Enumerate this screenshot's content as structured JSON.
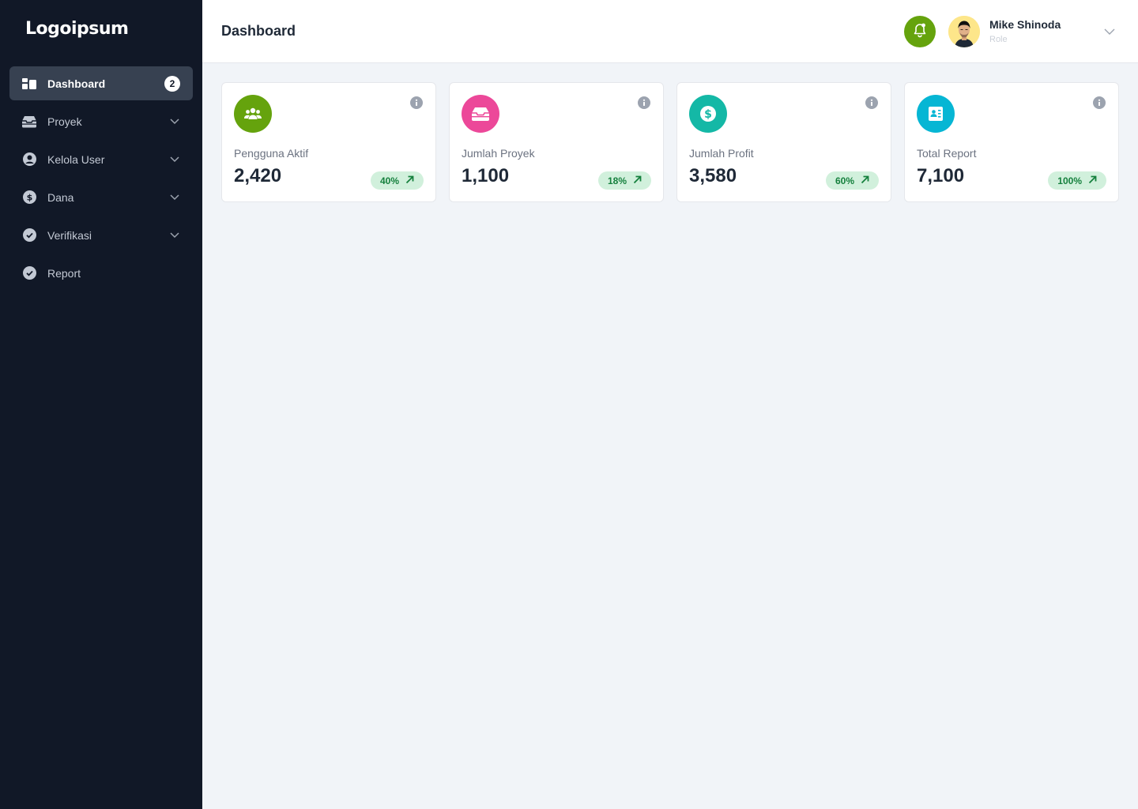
{
  "brand": {
    "logo_text": "Logoipsum"
  },
  "sidebar": {
    "items": [
      {
        "label": "Dashboard",
        "icon": "dashboard-icon",
        "badge": "2",
        "active": true
      },
      {
        "label": "Proyek",
        "icon": "inbox-icon",
        "expandable": true
      },
      {
        "label": "Kelola User",
        "icon": "user-circle-icon",
        "expandable": true
      },
      {
        "label": "Dana",
        "icon": "dollar-circle-icon",
        "expandable": true
      },
      {
        "label": "Verifikasi",
        "icon": "check-circle-icon",
        "expandable": true
      },
      {
        "label": "Report",
        "icon": "check-circle-icon"
      }
    ]
  },
  "header": {
    "title": "Dashboard",
    "user": {
      "name": "Mike Shinoda",
      "role": "Role"
    }
  },
  "cards": [
    {
      "label": "Pengguna Aktif",
      "value": "2,420",
      "trend": "40%",
      "icon": "users-icon",
      "color": "#65a30d"
    },
    {
      "label": "Jumlah Proyek",
      "value": "1,100",
      "trend": "18%",
      "icon": "inbox-icon",
      "color": "#ec4899"
    },
    {
      "label": "Jumlah Profit",
      "value": "3,580",
      "trend": "60%",
      "icon": "dollar-icon",
      "color": "#14b8a6"
    },
    {
      "label": "Total Report",
      "value": "7,100",
      "trend": "100%",
      "icon": "report-icon",
      "color": "#06b6d4"
    }
  ],
  "colors": {
    "sidebar_bg": "#111827",
    "active_item_bg": "#374151",
    "page_bg": "#f1f4f8",
    "trend_bg": "#d1f0dc",
    "trend_text": "#15803d",
    "bell_bg": "#65a30d"
  }
}
